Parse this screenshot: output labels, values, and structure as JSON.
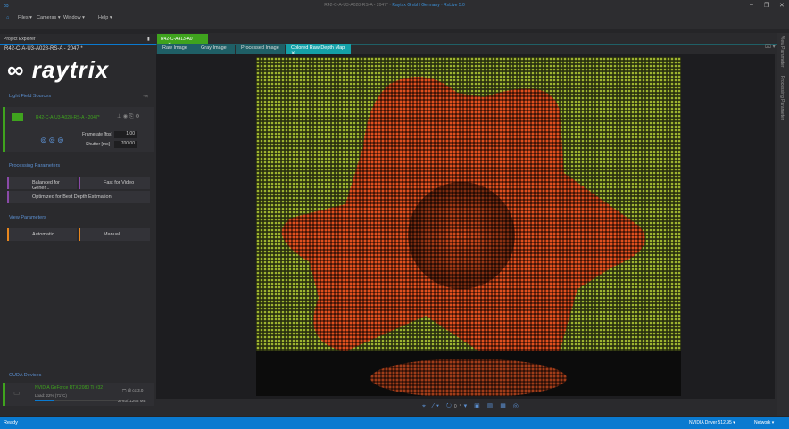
{
  "window": {
    "title": "R42-C-A-U3-A028-RS-A - 2047*",
    "title_suffix": "Raytrix GmbH Germany · RxLive 5.0",
    "minimize": "–",
    "restore": "❐",
    "close": "✕"
  },
  "menu": {
    "files": "Files ▾",
    "cameras": "Cameras ▾",
    "window": "Window ▾",
    "help": "Help ▾"
  },
  "explorer": {
    "header": "Project Explorer",
    "pin": "▮",
    "project": "R42-C-A-U3-A028-RS-A - 2047 *",
    "logo": "raytrix"
  },
  "light_field": {
    "header": "Light Field Sources",
    "camera": "R42-C-A-U3-A028-RS-A - 2047*",
    "framerate_label": "Framerate [fps]",
    "framerate": "1.00",
    "shutter_label": "Shutter [ms]",
    "shutter": "700.00"
  },
  "processing": {
    "header": "Processing Parameters",
    "items": [
      "Balanced for Gener...",
      "Fast for Video",
      "Optimized for Best Depth Estimation"
    ]
  },
  "view_params": {
    "header": "View Parameters",
    "items": [
      "Automatic",
      "Manual"
    ]
  },
  "cuda": {
    "header": "CUDA Devices",
    "device": "NVIDIA GeForce RTX 2080 Ti #32",
    "load": "Load: 22%",
    "temp": "(71°C)",
    "compute": "@ cc 3.0",
    "memory": "2793/11263 MB",
    "load_fraction": 0.22
  },
  "doc_tab": {
    "label": "R42-C-A413-A0",
    "close": "✕"
  },
  "view_tabs": [
    "Raw Image",
    "Gray Image",
    "Processed Image",
    "Colored Raw Depth Map"
  ],
  "view_tab_close": "✕",
  "toolbar": {
    "rotation": "0°"
  },
  "right_panels": [
    "View Parameter",
    "Processing Parameter"
  ],
  "status": {
    "text": "Ready",
    "driver": "NVIDIA Driver 512.95 ▾",
    "network": "Network ▾"
  },
  "colors": {
    "accent": "#0a7ad0",
    "doc_tab": "#3fa31e",
    "active_view_tab": "#14a0a8",
    "depth_near": "#e0501e",
    "depth_far": "#9fb530"
  }
}
